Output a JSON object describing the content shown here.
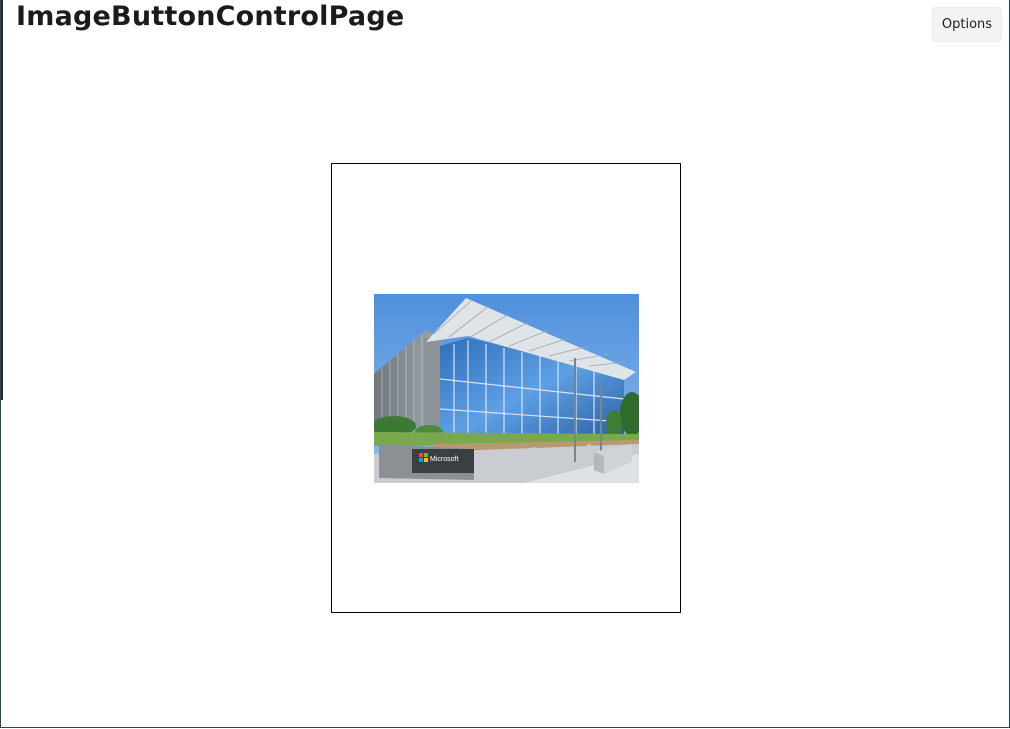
{
  "page": {
    "title": "ImageButtonControlPage"
  },
  "toolbar": {
    "options_label": "Options"
  },
  "image_button": {
    "image": "microsoft-building-photo",
    "sign_text": "Microsoft"
  },
  "colors": {
    "window_border": "#1f4a66",
    "button_bg": "#f3f3f3",
    "image_button_border": "#000000",
    "sky": "#5b9be0",
    "ms_red": "#f25022",
    "ms_green": "#7fba00",
    "ms_blue": "#00a4ef",
    "ms_yellow": "#ffb900"
  }
}
